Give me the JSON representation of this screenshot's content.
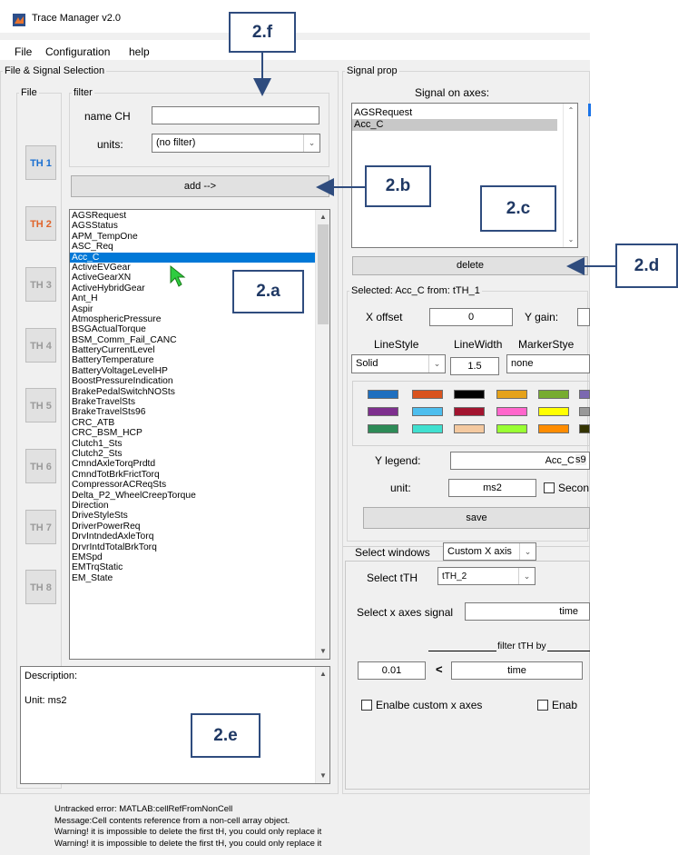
{
  "window": {
    "title": "Trace Manager v2.0"
  },
  "menu": {
    "items": [
      "File",
      "Configuration",
      "help"
    ]
  },
  "panels": {
    "file_signal": "File & Signal Selection",
    "file": "File",
    "filter": "filter",
    "signal_prop": "Signal prop"
  },
  "filter": {
    "name_label": "name CH",
    "name_value": "",
    "units_label": "units:",
    "units_value": "(no filter)"
  },
  "th_buttons": [
    "TH 1",
    "TH 2",
    "TH 3",
    "TH 4",
    "TH 5",
    "TH 6",
    "TH 7",
    "TH 8"
  ],
  "th_colors": {
    "active1": "#1a6fd0",
    "active2": "#e0642a",
    "inactive": "#9a9a9a"
  },
  "add_button": "add -->",
  "signals": [
    "AGSRequest",
    "AGSStatus",
    "APM_TempOne",
    "ASC_Req",
    "Acc_C",
    "ActiveEVGear",
    "ActiveGearXN",
    "ActiveHybridGear",
    "Ant_H",
    "Aspir",
    "AtmosphericPressure",
    "BSGActualTorque",
    "BSM_Comm_Fail_CANC",
    "BatteryCurrentLevel",
    "BatteryTemperature",
    "BatteryVoltageLevelHP",
    "BoostPressureIndication",
    "BrakePedalSwitchNOSts",
    "BrakeTravelSts",
    "BrakeTravelSts96",
    "CRC_ATB",
    "CRC_BSM_HCP",
    "Clutch1_Sts",
    "Clutch2_Sts",
    "CmndAxleTorqPrdtd",
    "CmndTotBrkFrictTorq",
    "CompressorACReqSts",
    "Delta_P2_WheelCreepTorque",
    "Direction",
    "DriveStyleSts",
    "DriverPowerReq",
    "DrvIntndedAxleTorq",
    "DrvrIntdTotalBrkTorq",
    "EMSpd",
    "EMTrqStatic",
    "EM_State"
  ],
  "selected_signal_index": 4,
  "description": {
    "label": "Description:",
    "unit": "Unit: ms2"
  },
  "signal_prop": {
    "axes_label": "Signal on axes:",
    "axes_signals": [
      "AGSRequest",
      "Acc_C"
    ],
    "delete_button": "delete",
    "selected_header": "Selected: Acc_C   from: tTH_1",
    "x_offset_label": "X offset",
    "x_offset_value": "0",
    "y_gain_label": "Y gain:",
    "y_gain_value": "",
    "linestyle_label": "LineStyle",
    "linewidth_label": "LineWidth",
    "markerstyle_label": "MarkerStye",
    "linestyle_value": "Solid",
    "linewidth_value": "1.5",
    "markerstyle_value": "none",
    "palette": [
      [
        "#1f6fbf",
        "#d9531e",
        "#000000",
        "#e5a21a",
        "#77ac30",
        "#7b68b0"
      ],
      [
        "#7e2f8e",
        "#4dbeee",
        "#a2142f",
        "#ff66cc",
        "#ffff00",
        "#999999"
      ],
      [
        "#2e8b57",
        "#40e0d0",
        "#f4c9a0",
        "#99ff33",
        "#ff8c00",
        "#333300"
      ]
    ],
    "ylegend_label": "Y legend:",
    "ylegend_value": "Acc_C",
    "ylegend_suffix": "s9",
    "unit_label": "unit:",
    "unit_value": "ms2",
    "second_label": "Secon",
    "save_button": "save"
  },
  "select_windows": {
    "tab_label": "Select windows",
    "dropdown_value": "Custom X axis",
    "select_tth_label": "Select tTH",
    "select_tth_value": "tTH_2",
    "x_signal_label": "Select x axes signal",
    "x_signal_value": "time",
    "filter_label": "filter tTH by",
    "filter_value": "0.01",
    "filter_op": "<",
    "filter_field": "time",
    "enable_custom_label": "Enalbe custom x axes",
    "enable_f_label": "Enab"
  },
  "status": [
    "Untracked error: MATLAB:cellRefFromNonCell",
    "Message:Cell contents reference from a non-cell array object.",
    "Warning! it is impossible to delete the first tH, you could only replace it",
    "Warning! it is impossible to delete the first tH, you could only replace it"
  ],
  "callouts": [
    "2.f",
    "2.b",
    "2.c",
    "2.a",
    "2.d",
    "2.e"
  ],
  "colors": {
    "accent": "#0078d7",
    "callout": "#2f4c7e",
    "cursor": "#2ecc40"
  }
}
